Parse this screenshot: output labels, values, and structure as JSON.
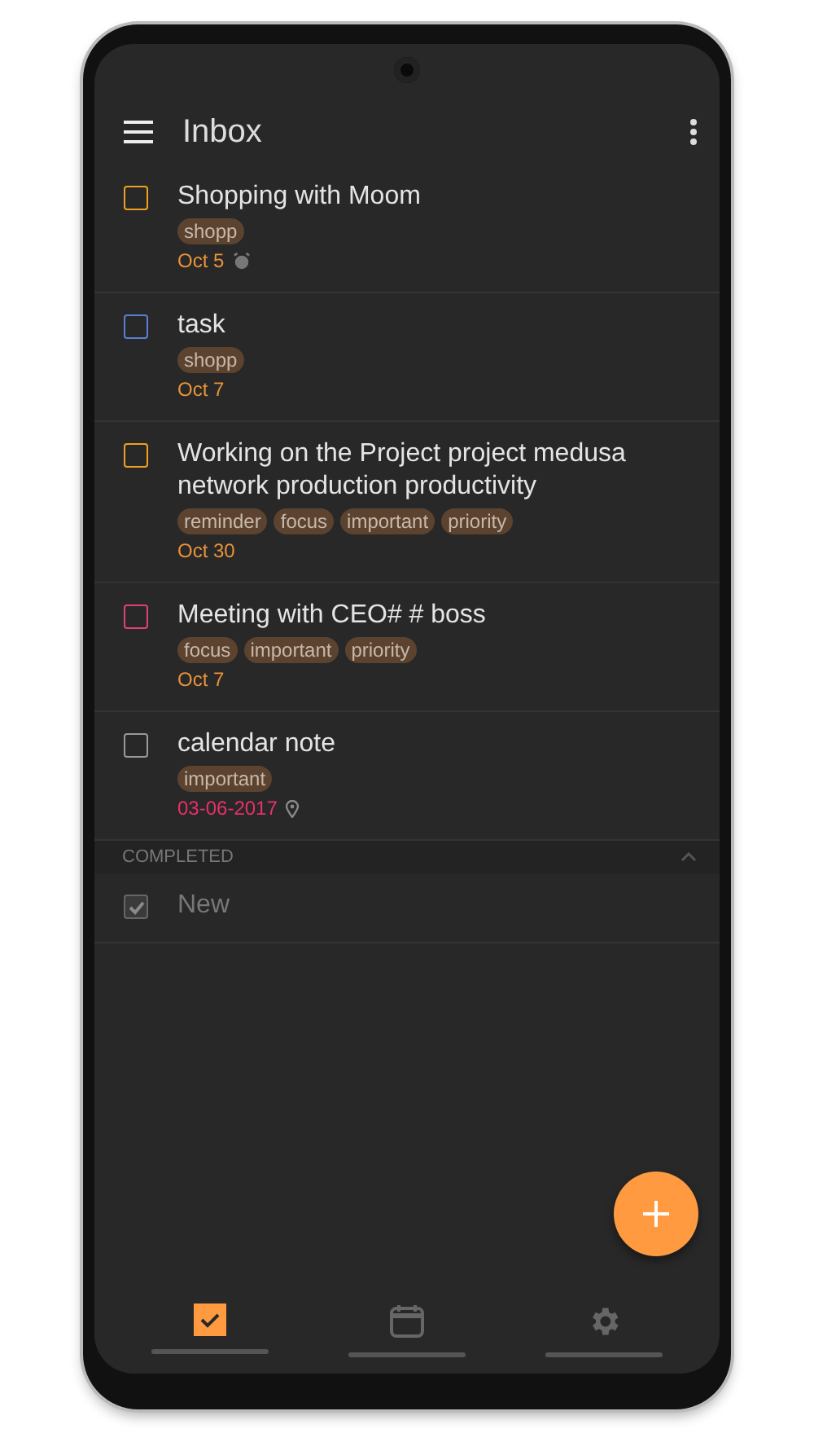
{
  "app_bar": {
    "title": "Inbox"
  },
  "tasks": [
    {
      "title": "Shopping with Moom",
      "color": "#f0a020",
      "checked": false,
      "tags": [
        "shopp"
      ],
      "date": {
        "text": "Oct 5",
        "color": "#e8923a",
        "kind": "alarm"
      }
    },
    {
      "title": "task",
      "color": "#5b7fd6",
      "checked": false,
      "tags": [
        "shopp"
      ],
      "date": {
        "text": "Oct 7",
        "color": "#e8923a"
      }
    },
    {
      "title": "Working on the Project project medusa network production productivity",
      "color": "#f0a020",
      "checked": false,
      "tags": [
        "reminder",
        "focus",
        "important",
        "priority"
      ],
      "date": {
        "text": "Oct 30",
        "color": "#e8923a"
      }
    },
    {
      "title": "Meeting with CEO# # boss",
      "color": "#e0407a",
      "checked": false,
      "tags": [
        "focus",
        "important",
        "priority"
      ],
      "date": {
        "text": "Oct 7",
        "color": "#e8923a"
      }
    },
    {
      "title": "calendar note",
      "color": "#9a9a9a",
      "checked": false,
      "tags": [
        "important"
      ],
      "date": {
        "text": "03-06-2017",
        "color": "#e8306a",
        "kind": "location"
      }
    }
  ],
  "completed": {
    "label": "COMPLETED",
    "expanded": true,
    "items": [
      {
        "title": "New",
        "checked": true
      }
    ]
  },
  "nav": [
    {
      "kind": "tasks",
      "selected": true
    },
    {
      "kind": "calendar",
      "selected": false
    },
    {
      "kind": "settings",
      "selected": false
    }
  ]
}
